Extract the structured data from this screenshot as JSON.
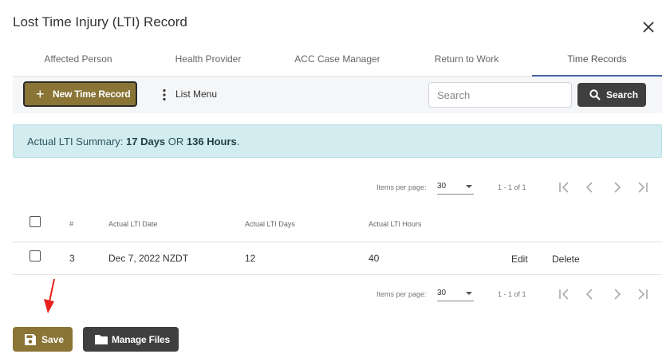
{
  "dialog": {
    "title": "Lost Time Injury (LTI) Record"
  },
  "tabs": [
    {
      "label": "Affected Person"
    },
    {
      "label": "Health Provider"
    },
    {
      "label": "ACC Case Manager"
    },
    {
      "label": "Return to Work"
    },
    {
      "label": "Time Records",
      "active": true
    }
  ],
  "toolbar": {
    "new_label": "New Time Record",
    "list_menu_label": "List Menu",
    "search_placeholder": "Search",
    "search_value": "",
    "search_button_label": "Search"
  },
  "summary": {
    "prefix": "Actual LTI Summary: ",
    "days": "17 Days",
    "joiner": " OR ",
    "hours": "136 Hours",
    "suffix": "."
  },
  "pagination": {
    "items_per_page_label": "Items per page:",
    "page_size": "30",
    "range": "1 - 1 of 1"
  },
  "table": {
    "columns": [
      "#",
      "Actual LTI Date",
      "Actual LTI Days",
      "Actual LTI Hours"
    ],
    "rows": [
      {
        "num": "3",
        "date": "Dec 7, 2022 NZDT",
        "days": "12",
        "hours": "40",
        "edit": "Edit",
        "delete": "Delete"
      }
    ]
  },
  "footer": {
    "save_label": "Save",
    "manage_files_label": "Manage Files"
  },
  "colors": {
    "primary_gold": "#8a7436",
    "dark_button": "#3f3f3f",
    "info_banner": "#d2ecef",
    "active_tab": "#4a68a8",
    "arrow": "#e8211c"
  }
}
